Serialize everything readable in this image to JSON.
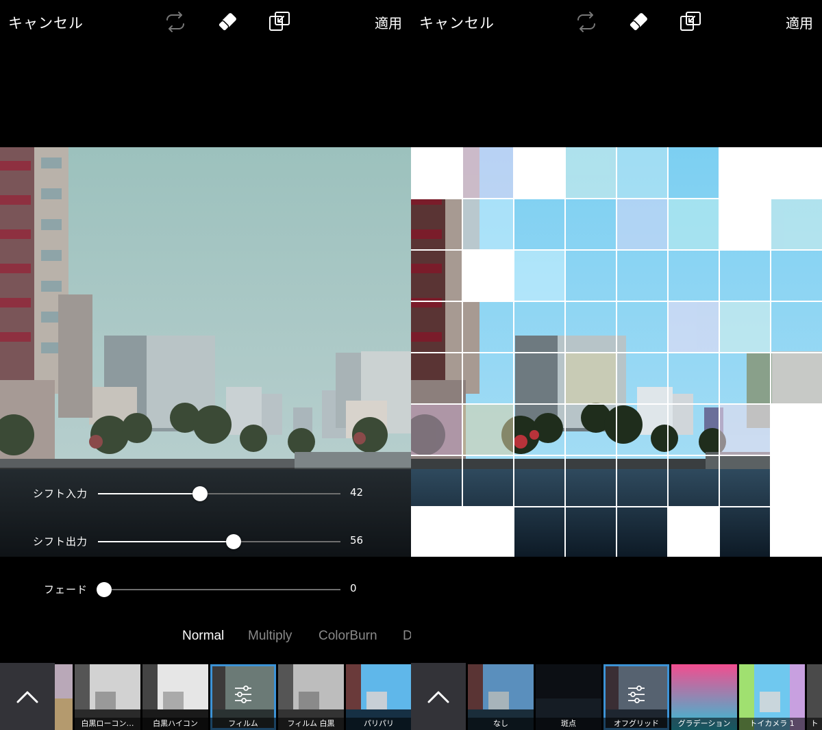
{
  "left_panel": {
    "topbar": {
      "cancel": "キャンセル",
      "apply": "適用"
    },
    "icons": [
      "repeat-icon",
      "eraser-icon",
      "resize-icon"
    ],
    "sliders": [
      {
        "label": "シフト入力",
        "value": "42",
        "level": 0.42
      },
      {
        "label": "シフト出力",
        "value": "56",
        "level": 0.56
      },
      {
        "label": "フェード",
        "value": "0",
        "level": 0
      }
    ],
    "blend_modes": [
      "Normal",
      "Multiply",
      "ColorBurn",
      "D"
    ],
    "selected_blend": "Normal",
    "filters": [
      {
        "label": ""
      },
      {
        "label": "白黒ローコン…"
      },
      {
        "label": "白黒ハイコン"
      },
      {
        "label": "フィルム",
        "selected": true
      },
      {
        "label": "フィルム 白黒"
      },
      {
        "label": "パリパリ"
      }
    ]
  },
  "right_panel": {
    "topbar": {
      "cancel": "キャンセル",
      "apply": "適用"
    },
    "icons": [
      "repeat-icon",
      "eraser-icon",
      "resize-icon"
    ],
    "filters": [
      {
        "label": "なし"
      },
      {
        "label": "斑点"
      },
      {
        "label": "オフグリッド",
        "selected": true
      },
      {
        "label": "グラデーション"
      },
      {
        "label": "トイカメラ 1"
      },
      {
        "label": "ト"
      }
    ]
  },
  "colors": {
    "accent": "#3d93d6",
    "background": "#000000",
    "strip_button": "#333338",
    "inactive_text": "#8a8a8a"
  }
}
